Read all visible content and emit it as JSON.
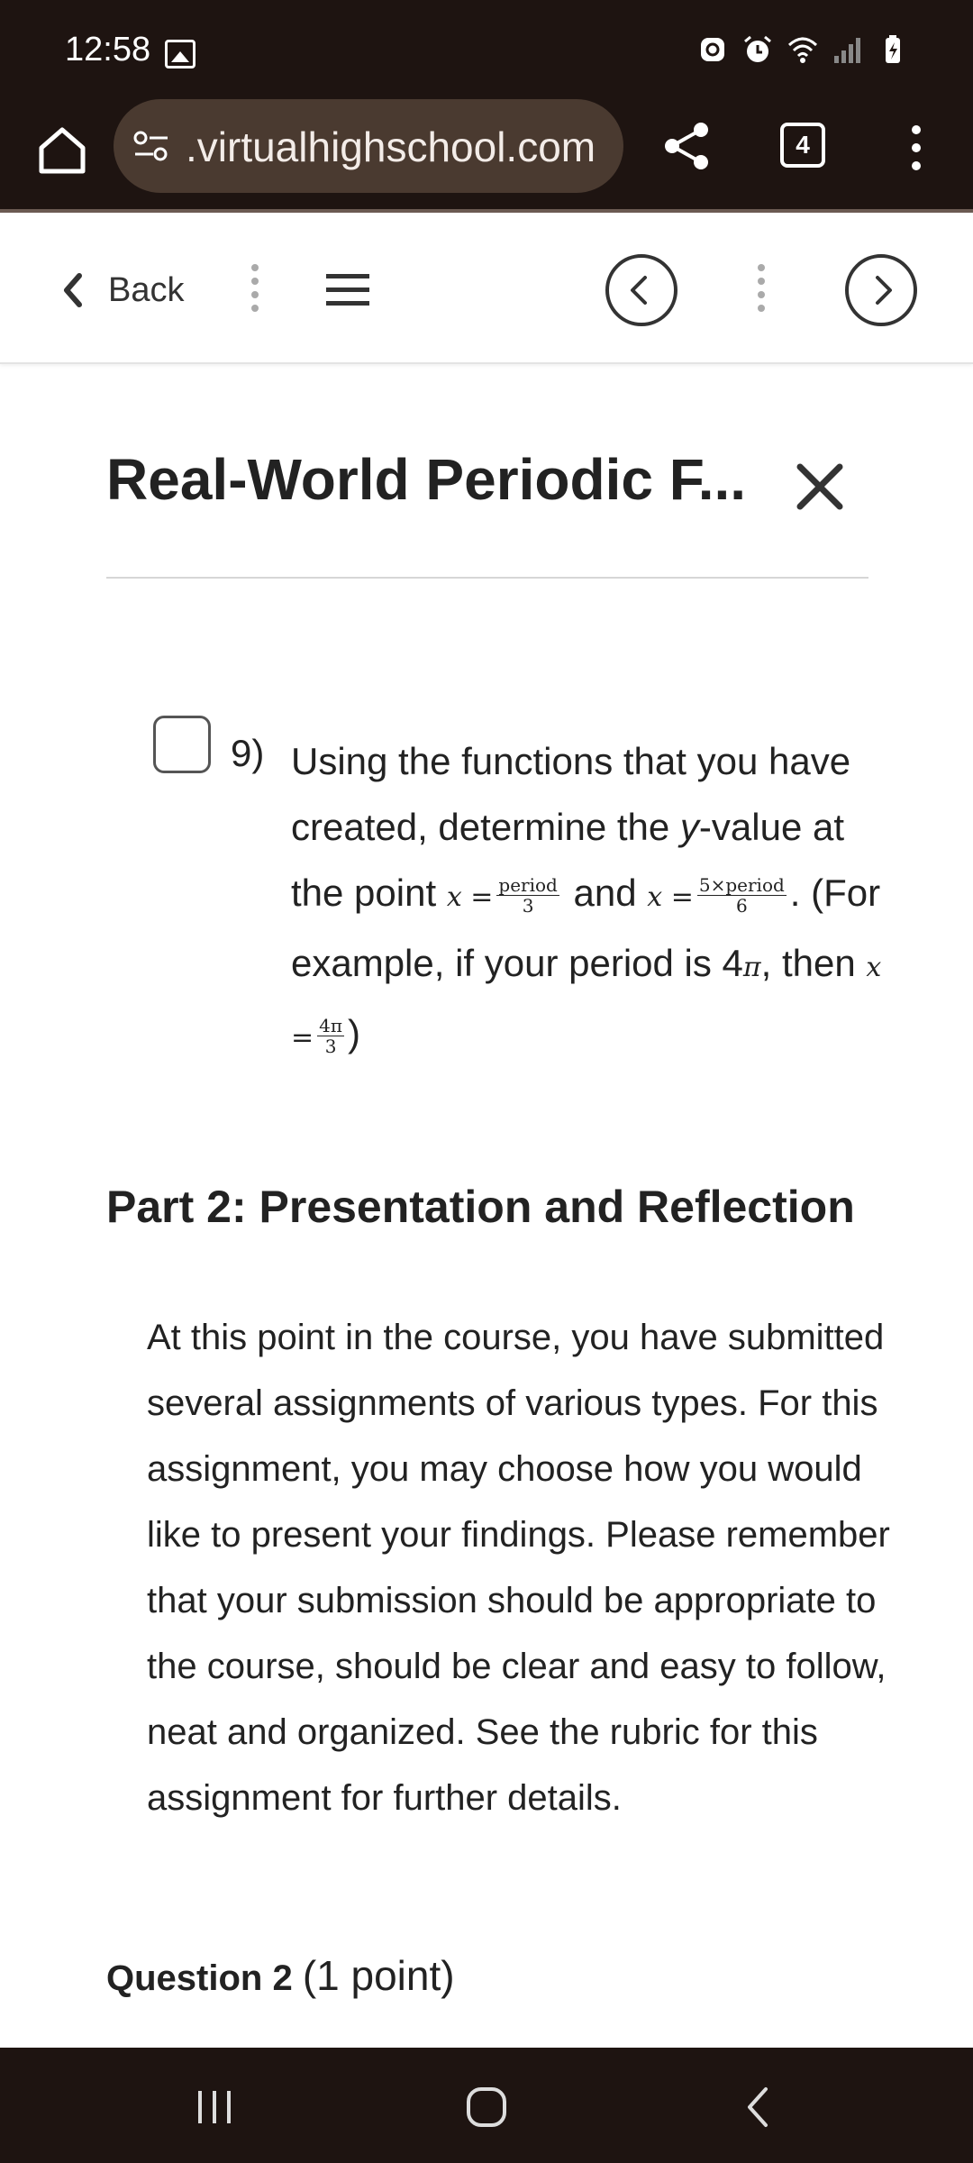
{
  "status_bar": {
    "time": "12:58"
  },
  "browser": {
    "url": ".virtualhighschool.com",
    "tab_count": "4"
  },
  "course_nav": {
    "back_label": "Back"
  },
  "page": {
    "title": "Real-World Periodic F..."
  },
  "question9": {
    "number": "9)",
    "text_part1": "Using the functions that you have created, determine the ",
    "y_var": "y",
    "text_part2": "-value at the point ",
    "eq1_lhs": "x =",
    "eq1_num": "period",
    "eq1_den": "3",
    "and": " and ",
    "eq2_lhs": "x =",
    "eq2_num": "5×period",
    "eq2_den": "6",
    "period_end": ".",
    "example_prefix": "(For example, if your period is 4",
    "pi": "π",
    "example_mid": ", then ",
    "eq3_lhs": "x =",
    "eq3_num": "4π",
    "eq3_den": "3",
    "example_end": ")"
  },
  "part2": {
    "heading": "Part 2: Presentation and Reflection",
    "body": "At this point in the course, you have submitted several assignments of various types. For this assignment, you may choose how you would like to present your findings. Please remember that your submission should be appropriate to the course, should be clear and easy to follow, neat and organized. See the rubric for this assignment for further details."
  },
  "question2": {
    "title": "Question 2",
    "points": "(1 point)"
  }
}
